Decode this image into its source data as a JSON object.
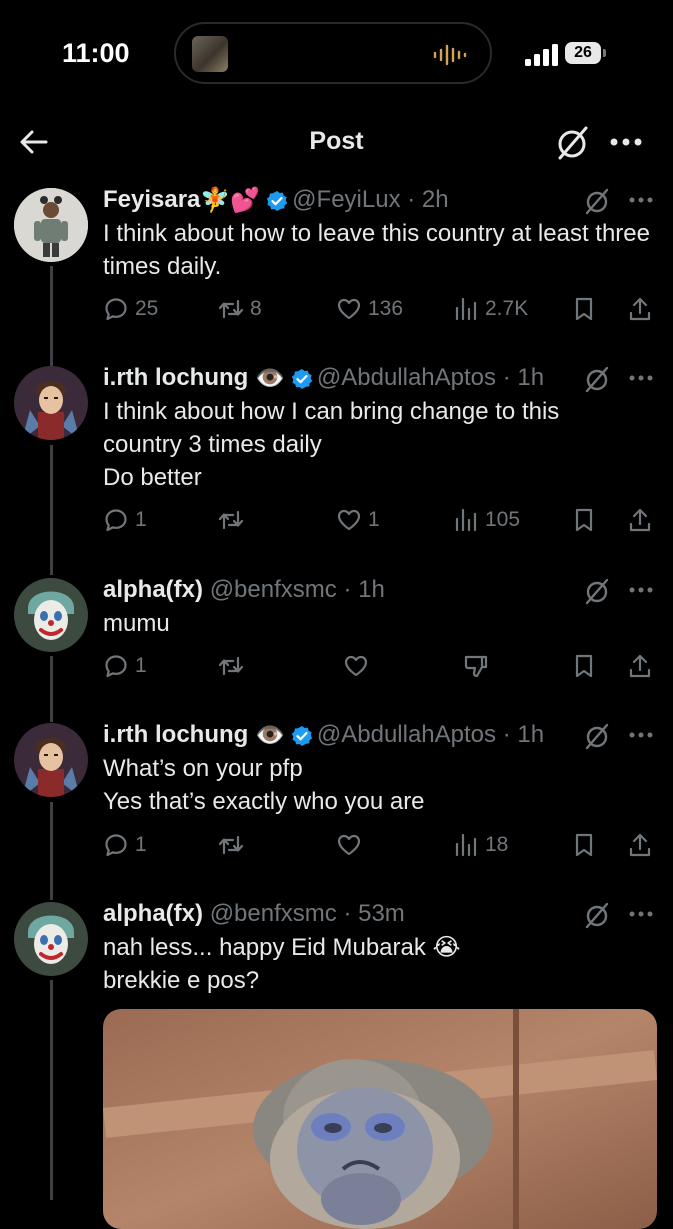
{
  "status_bar": {
    "time": "11:00",
    "battery": "26"
  },
  "header": {
    "title": "Post"
  },
  "tweets": [
    {
      "name": "Feyisara",
      "name_emojis": "🧚💕",
      "handle": "@FeyiLux",
      "time": "· 2h",
      "text": "I think about how to leave this country at least three times daily.",
      "replies": "25",
      "reposts": "8",
      "likes": "136",
      "views": "2.7K"
    },
    {
      "name": "i.rth lochung",
      "name_emojis": "👁️",
      "handle": "@AbdullahAptos",
      "time": "· 1h",
      "text": "I think about how I can bring change to this\ncountry 3 times daily\nDo better",
      "replies": "1",
      "reposts": "",
      "likes": "1",
      "views": "105"
    },
    {
      "name": "alpha(fx)",
      "handle": "@benfxsmc",
      "time": "· 1h",
      "text": "mumu",
      "replies": "1",
      "reposts": "",
      "likes": ""
    },
    {
      "name": "i.rth lochung",
      "name_emojis": "👁️",
      "handle": "@AbdullahAptos",
      "time": "· 1h",
      "text": "What’s on your pfp\nYes that’s exactly who you are",
      "replies": "1",
      "reposts": "",
      "likes": "",
      "views": "18"
    },
    {
      "name": "alpha(fx)",
      "handle": "@benfxsmc",
      "time": "· 53m",
      "text": "nah less... happy Eid Mubarak 😭\nbrekkie e pos?",
      "replies": "",
      "reposts": "",
      "likes": ""
    }
  ],
  "colors": {
    "background": "#000000",
    "text": "#e7e9ea",
    "muted": "#71767b",
    "verified": "#1d9bf0"
  },
  "icons": [
    "back-arrow-icon",
    "grok-icon",
    "more-icon",
    "reply-icon",
    "repost-icon",
    "like-icon",
    "views-icon",
    "bookmark-icon",
    "share-icon",
    "dislike-icon",
    "verified-badge-icon"
  ]
}
